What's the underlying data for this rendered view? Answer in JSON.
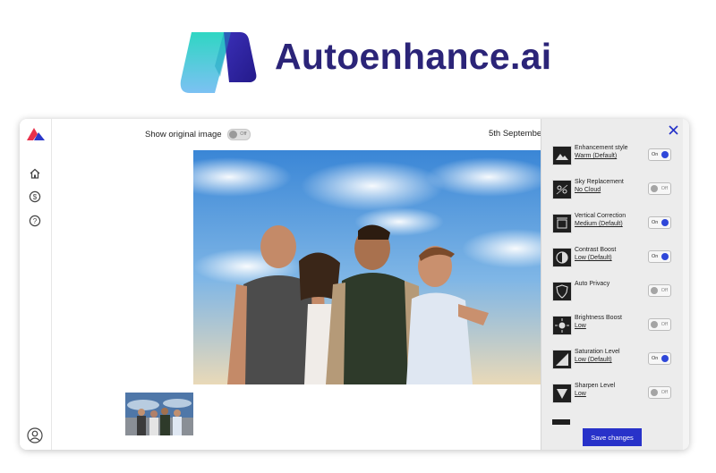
{
  "brand": {
    "name": "Autoenhance.ai"
  },
  "colors": {
    "brand_text": "#2b2478",
    "accent": "#2832c9",
    "toggle_on": "#2f47d9"
  },
  "toolbar": {
    "show_original_label": "Show original image",
    "show_original_toggle": "Off",
    "date": "5th September"
  },
  "sidebar": {
    "items": [
      {
        "icon": "home-icon"
      },
      {
        "icon": "dollar-icon"
      },
      {
        "icon": "help-icon"
      }
    ],
    "footer_icon": "user-icon"
  },
  "panel": {
    "close_icon": "close-icon",
    "options": [
      {
        "title": "Enhancement style",
        "value": "Warm (Default)",
        "switch": "On",
        "on": true,
        "icon": "landscape-icon"
      },
      {
        "title": "Sky Replacement",
        "value": "No Cloud",
        "switch": "Off",
        "on": false,
        "icon": "sky-icon"
      },
      {
        "title": "Vertical Correction",
        "value": "Medium (Default)",
        "switch": "On",
        "on": true,
        "icon": "vertical-correction-icon"
      },
      {
        "title": "Contrast Boost",
        "value": "Low (Default)",
        "switch": "On",
        "on": true,
        "icon": "contrast-icon"
      },
      {
        "title": "Auto Privacy",
        "value": "",
        "switch": "Off",
        "on": false,
        "icon": "privacy-shield-icon"
      },
      {
        "title": "Brightness Boost",
        "value": "Low",
        "switch": "Off",
        "on": false,
        "icon": "brightness-icon"
      },
      {
        "title": "Saturation Level",
        "value": "Low (Default)",
        "switch": "On",
        "on": true,
        "icon": "saturation-icon"
      },
      {
        "title": "Sharpen Level",
        "value": "Low",
        "switch": "Off",
        "on": false,
        "icon": "sharpen-icon"
      }
    ],
    "save_label": "Save changes"
  }
}
